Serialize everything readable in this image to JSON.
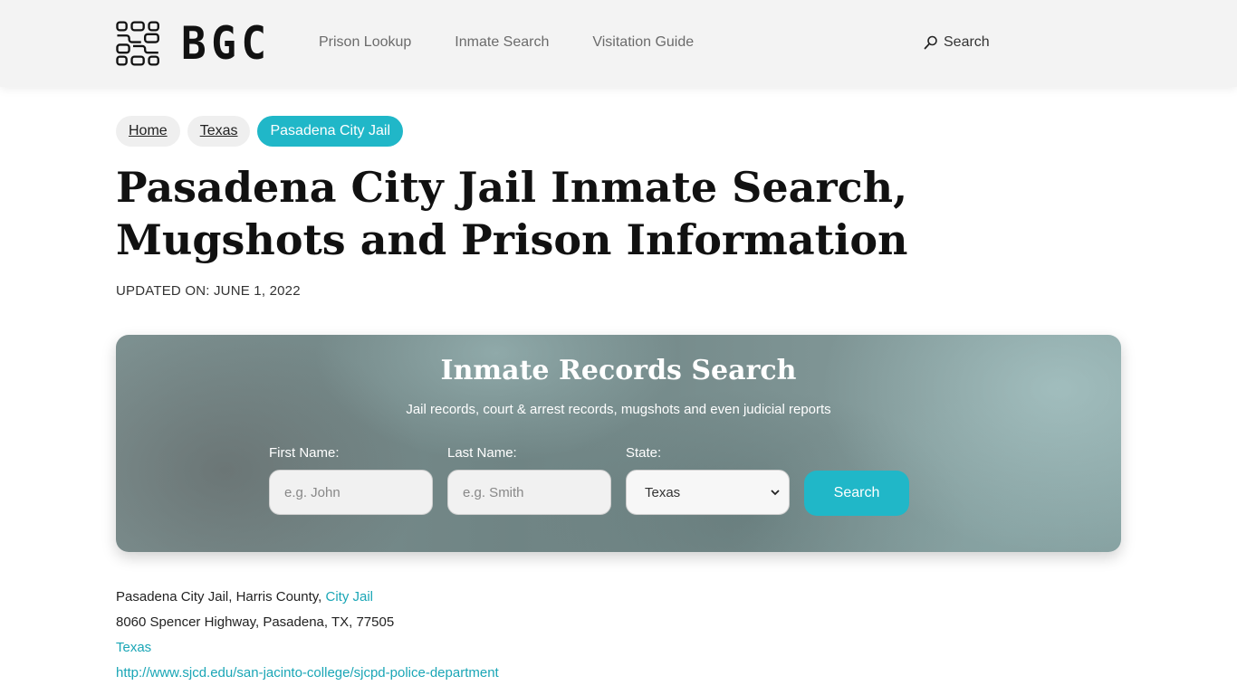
{
  "header": {
    "logo_text": "BGC",
    "nav": [
      "Prison Lookup",
      "Inmate Search",
      "Visitation Guide"
    ],
    "search_label": "Search"
  },
  "breadcrumb": [
    "Home",
    "Texas",
    "Pasadena City Jail"
  ],
  "page_title": "Pasadena City Jail Inmate Search, Mugshots and Prison Information",
  "updated": "UPDATED ON: JUNE 1, 2022",
  "search_card": {
    "title": "Inmate Records Search",
    "subtitle": "Jail records, court & arrest records, mugshots and even judicial reports",
    "first_name": {
      "label": "First Name:",
      "placeholder": "e.g. John"
    },
    "last_name": {
      "label": "Last Name:",
      "placeholder": "e.g. Smith"
    },
    "state": {
      "label": "State:",
      "value": "Texas"
    },
    "button": "Search"
  },
  "info": {
    "facility": "Pasadena City Jail, Harris County,",
    "facility_type": "City Jail",
    "address": "8060 Spencer Highway, Pasadena, TX, 77505",
    "state_link": "Texas",
    "url": "http://www.sjcd.edu/san-jacinto-college/sjcpd-police-department"
  },
  "colors": {
    "accent": "#20b7c8",
    "link": "#1aa6b6"
  }
}
